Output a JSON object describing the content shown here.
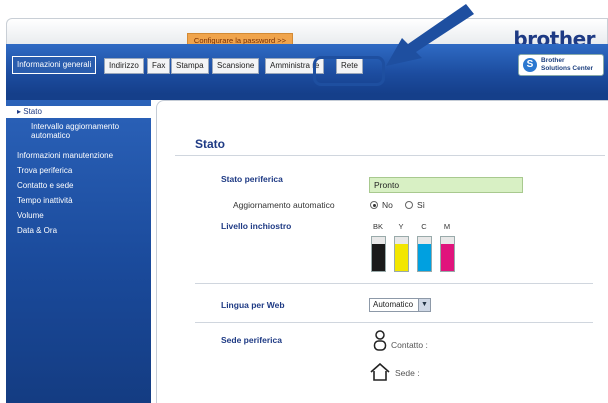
{
  "header": {
    "password_link": "Configurare la password >>",
    "brand": "brother",
    "solutions_line1": "Brother",
    "solutions_line2": "Solutions Center",
    "solutions_icon": "S"
  },
  "tabs": [
    {
      "label": "Informazioni generali",
      "active": true
    },
    {
      "label": "Indirizzo",
      "active": false
    },
    {
      "label": "Fax",
      "active": false
    },
    {
      "label": "Stampa",
      "active": false
    },
    {
      "label": "Scansione",
      "active": false
    },
    {
      "label": "Amministra   re",
      "active": false
    },
    {
      "label": "Rete",
      "active": false
    }
  ],
  "sidebar": {
    "items": [
      {
        "label": "▸ Stato"
      },
      {
        "label": "Intervallo aggiornamento"
      },
      {
        "label": "automatico"
      },
      {
        "label": "Informazioni manutenzione"
      },
      {
        "label": "Trova periferica"
      },
      {
        "label": "Contatto e sede"
      },
      {
        "label": "Tempo inattività"
      },
      {
        "label": "Volume"
      },
      {
        "label": "Data & Ora"
      }
    ]
  },
  "main": {
    "title": "Stato",
    "device_status_label": "Stato periferica",
    "device_status_value": "Pronto",
    "auto_refresh_label": "Aggiornamento automatico",
    "radio_no": "No",
    "radio_yes": "Sì",
    "ink_level_label": "Livello inchiostro",
    "inks": [
      {
        "name": "BK",
        "color": "#1a1a1a",
        "level": 0.8
      },
      {
        "name": "Y",
        "color": "#f2e600",
        "level": 0.8
      },
      {
        "name": "C",
        "color": "#00a0e0",
        "level": 0.8
      },
      {
        "name": "M",
        "color": "#e0147c",
        "level": 0.8
      }
    ],
    "web_language_label": "Lingua per Web",
    "web_language_value": "Automatico",
    "location_label": "Sede periferica",
    "contact_label": "Contatto :",
    "location_value_label": "Sede :"
  },
  "colors": {
    "accent": "#1e3a84",
    "sidebar_bg": "#1a4a9b",
    "password_button": "#f0a44c",
    "status_box": "#d8f0c4",
    "callout": "#1e4fa0"
  }
}
